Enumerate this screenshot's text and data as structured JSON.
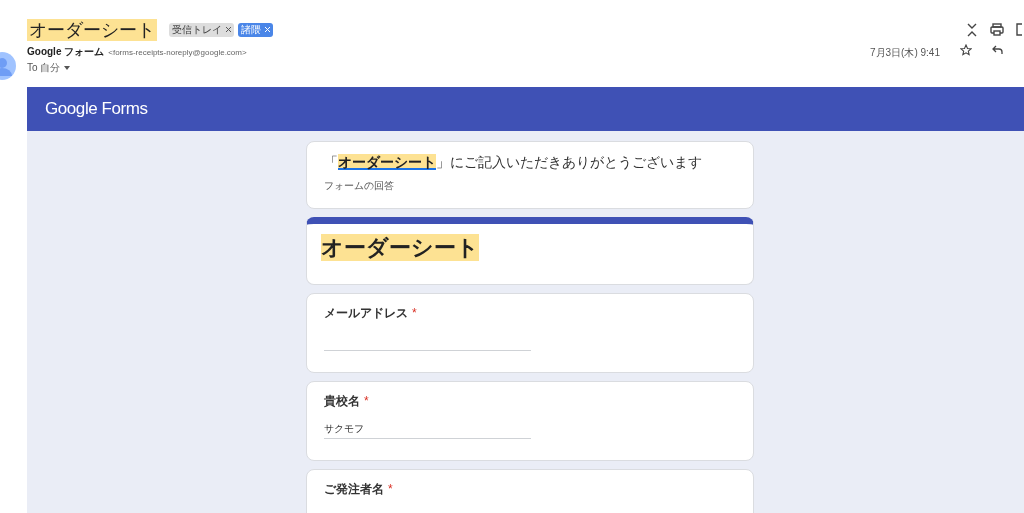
{
  "email": {
    "subject": "オーダーシート",
    "labels": [
      {
        "text": "受信トレイ",
        "color": "#dddddd"
      },
      {
        "text": "諸隈",
        "color": "#4a86e8"
      }
    ],
    "sender_name": "Google フォーム",
    "sender_address": "<forms-receipts-noreply@google.com>",
    "recipient": "To 自分",
    "date": "7月3日(木) 9:41"
  },
  "form": {
    "brand": "Google Forms",
    "thanks": {
      "before": "「",
      "link": "オーダーシート",
      "after": "」にご記入いただきありがとうございます"
    },
    "subtitle": "フォームの回答",
    "title": "オーダーシート",
    "questions": [
      {
        "label": "メールアドレス",
        "required_mark": "*"
      },
      {
        "label": "貴校名",
        "required_mark": "*",
        "value": "サクモフ"
      },
      {
        "label": "ご発注者名",
        "required_mark": "*"
      }
    ]
  }
}
